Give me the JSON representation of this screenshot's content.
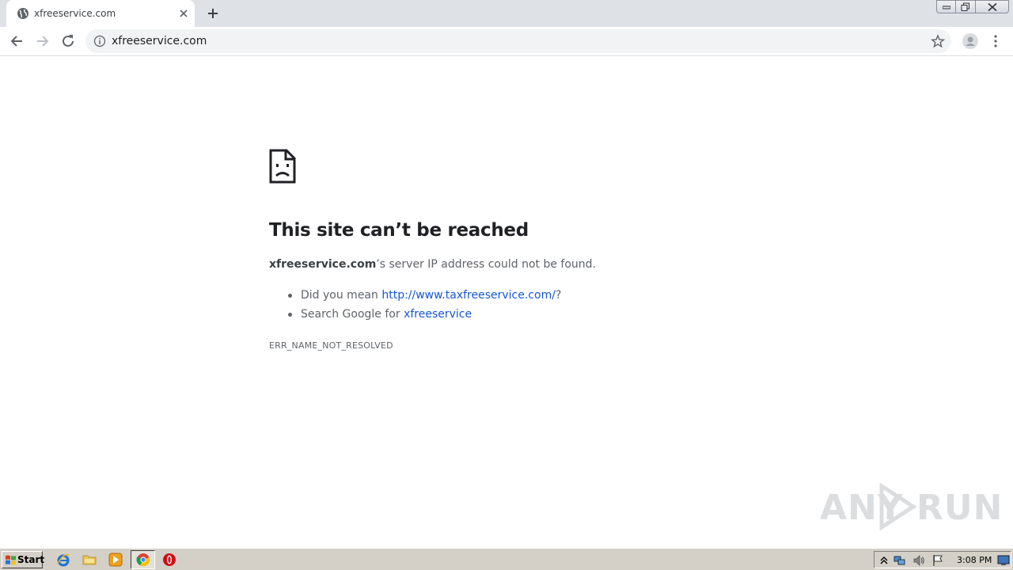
{
  "browser": {
    "tab_title": "xfreeservice.com",
    "url": "xfreeservice.com"
  },
  "error": {
    "title": "This site can’t be reached",
    "host": "xfreeservice.com",
    "desc_rest": "’s server IP address could not be found.",
    "suggestion1_prefix": "Did you mean ",
    "suggestion1_link": "http://www.taxfreeservice.com/",
    "suggestion1_suffix": "?",
    "suggestion2_prefix": "Search Google for ",
    "suggestion2_link": "xfreeservice",
    "code": "ERR_NAME_NOT_RESOLVED"
  },
  "watermark": {
    "left": "ANY",
    "right": "RUN"
  },
  "taskbar": {
    "start_label": "Start",
    "clock": "3:08 PM"
  },
  "icons": [
    "globe-icon",
    "close-icon",
    "plus-icon",
    "back-arrow-icon",
    "forward-arrow-icon",
    "reload-icon",
    "info-icon",
    "star-icon",
    "avatar-icon",
    "menu-dots-icon",
    "sad-page-icon",
    "windows-flag-icon",
    "ie-icon",
    "folder-icon",
    "media-player-icon",
    "chrome-icon",
    "opera-icon",
    "tray-arrow-icon",
    "network-icon",
    "volume-icon",
    "flag-icon",
    "desktop-icon"
  ],
  "colors": {
    "tabstrip": "#dee1e6",
    "link": "#1558d6",
    "title": "#202124",
    "text": "#5f6368",
    "taskbar": "#d4d0c8"
  }
}
